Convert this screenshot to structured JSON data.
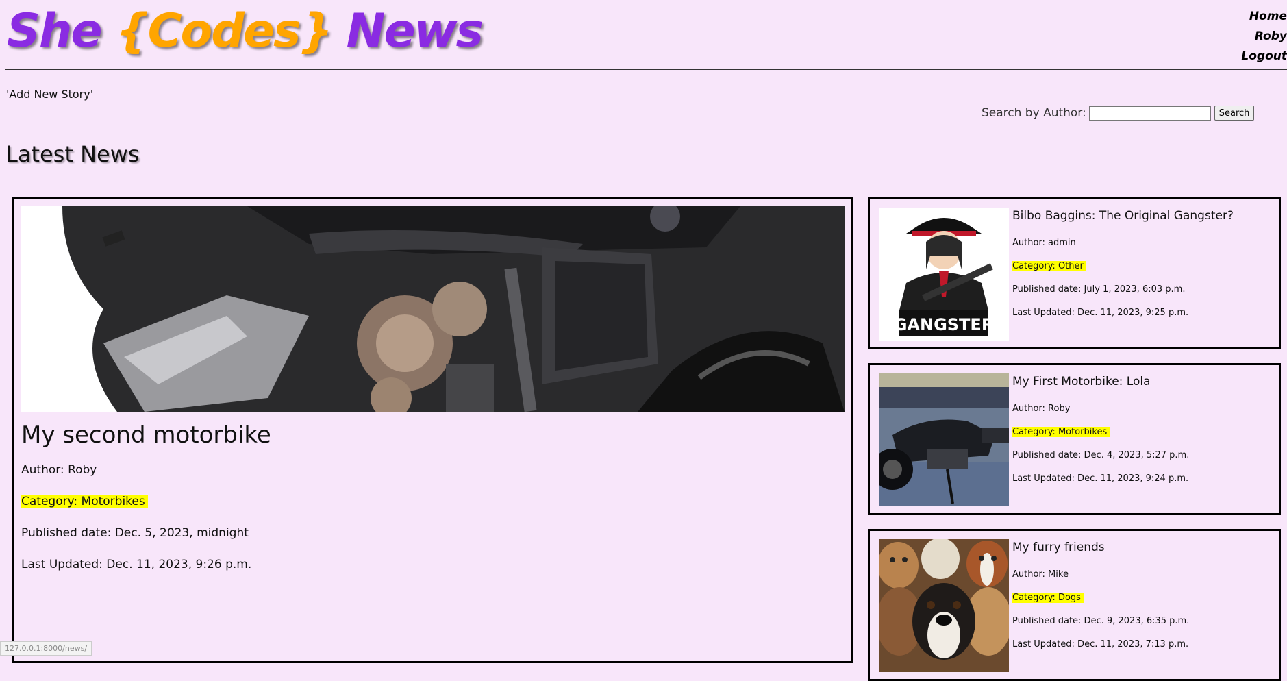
{
  "header": {
    "logo_she": "She",
    "logo_codes": "{Codes}",
    "logo_news": "News",
    "nav": {
      "home": "Home",
      "user": "Roby",
      "logout": "Logout"
    }
  },
  "add_story": "'Add New Story'",
  "search": {
    "label": "Search by Author:",
    "value": "",
    "button": "Search"
  },
  "page_title": "Latest News",
  "featured": {
    "title": "My second motorbike",
    "author": "Author: Roby",
    "category": "Category: Motorbikes",
    "published": "Published date: Dec. 5, 2023, midnight",
    "updated": "Last Updated: Dec. 11, 2023, 9:26 p.m."
  },
  "cards": [
    {
      "title": "Bilbo Baggins: The Original Gangster?",
      "author": "Author: admin",
      "category": "Category: Other",
      "published": "Published date: July 1, 2023, 6:03 p.m.",
      "updated": "Last Updated: Dec. 11, 2023, 9:25 p.m.",
      "image_label": "GANGSTER"
    },
    {
      "title": "My First Motorbike: Lola",
      "author": "Author: Roby",
      "category": "Category: Motorbikes",
      "published": "Published date: Dec. 4, 2023, 5:27 p.m.",
      "updated": "Last Updated: Dec. 11, 2023, 9:24 p.m."
    },
    {
      "title": "My furry friends",
      "author": "Author: Mike",
      "category": "Category: Dogs",
      "published": "Published date: Dec. 9, 2023, 6:35 p.m.",
      "updated": "Last Updated: Dec. 11, 2023, 7:13 p.m."
    }
  ],
  "status_url": "127.0.0.1:8000/news/",
  "colors": {
    "background": "#f8e6fa",
    "logo_purple": "#8a2be2",
    "logo_orange": "#ffa500",
    "highlight": "#ffff00"
  }
}
